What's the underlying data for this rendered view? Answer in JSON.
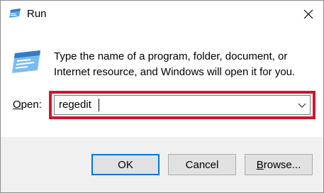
{
  "window": {
    "title": "Run",
    "title_icon": "run-app-icon",
    "close_icon": "close-icon"
  },
  "content": {
    "icon": "run-app-icon",
    "description": "Type the name of a program, folder, document, or Internet resource, and Windows will open it for you."
  },
  "open_field": {
    "label_accel": "O",
    "label_rest": "pen:",
    "value": "regedit",
    "dropdown_icon": "chevron-down-icon",
    "highlight_color": "#d0152e"
  },
  "buttons": {
    "ok": "OK",
    "cancel": "Cancel",
    "browse_accel": "B",
    "browse_rest": "rowse..."
  },
  "colors": {
    "default_button_border": "#0078d7",
    "footer_bg": "#f0f0f0"
  }
}
